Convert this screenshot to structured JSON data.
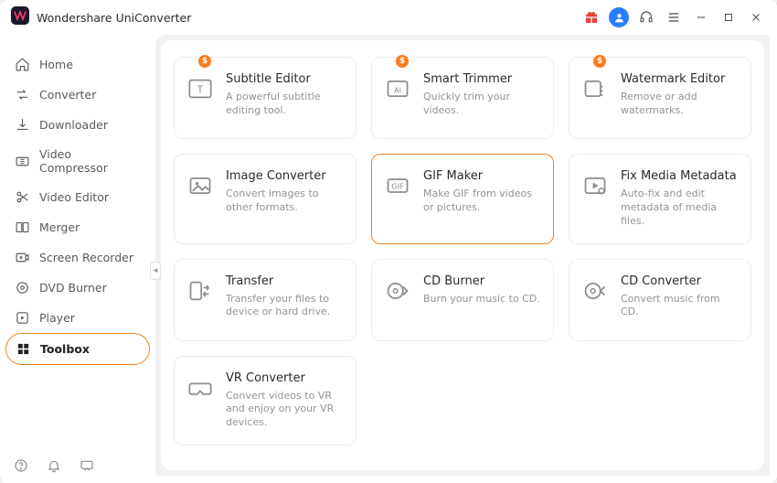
{
  "app": {
    "title": "Wondershare UniConverter"
  },
  "titlebar": {
    "gift_icon": "gift-icon",
    "avatar_icon": "user-icon",
    "support_icon": "headset-icon",
    "menu_icon": "menu-icon",
    "minimize_icon": "minimize-icon",
    "maximize_icon": "maximize-icon",
    "close_icon": "close-icon"
  },
  "sidebar": {
    "items": [
      {
        "icon": "home-icon",
        "label": "Home"
      },
      {
        "icon": "convert-icon",
        "label": "Converter"
      },
      {
        "icon": "download-icon",
        "label": "Downloader"
      },
      {
        "icon": "compress-icon",
        "label": "Video Compressor"
      },
      {
        "icon": "scissors-icon",
        "label": "Video Editor"
      },
      {
        "icon": "merge-icon",
        "label": "Merger"
      },
      {
        "icon": "record-icon",
        "label": "Screen Recorder"
      },
      {
        "icon": "disc-icon",
        "label": "DVD Burner"
      },
      {
        "icon": "play-icon",
        "label": "Player"
      },
      {
        "icon": "toolbox-icon",
        "label": "Toolbox"
      }
    ],
    "active_index": 9
  },
  "tools": [
    {
      "icon": "subtitle-icon",
      "title": "Subtitle Editor",
      "desc": "A powerful subtitle editing tool.",
      "badge": "$"
    },
    {
      "icon": "trim-icon",
      "title": "Smart Trimmer",
      "desc": "Quickly trim your videos.",
      "badge": "$"
    },
    {
      "icon": "watermark-icon",
      "title": "Watermark Editor",
      "desc": "Remove or add watermarks.",
      "badge": "$"
    },
    {
      "icon": "image-icon",
      "title": "Image Converter",
      "desc": "Convert images to other formats."
    },
    {
      "icon": "gif-icon",
      "title": "GIF Maker",
      "desc": "Make GIF from videos or pictures.",
      "highlight": true
    },
    {
      "icon": "metadata-icon",
      "title": "Fix Media Metadata",
      "desc": "Auto-fix and edit metadata of media files."
    },
    {
      "icon": "transfer-icon",
      "title": "Transfer",
      "desc": "Transfer your files to device or hard drive."
    },
    {
      "icon": "cdburn-icon",
      "title": "CD Burner",
      "desc": "Burn your music to CD."
    },
    {
      "icon": "cdconvert-icon",
      "title": "CD Converter",
      "desc": "Convert music from CD."
    },
    {
      "icon": "vr-icon",
      "title": "VR Converter",
      "desc": "Convert videos to VR and enjoy on your VR devices."
    }
  ],
  "footer": {
    "help_icon": "help-icon",
    "bell_icon": "bell-icon",
    "feedback_icon": "message-icon"
  }
}
